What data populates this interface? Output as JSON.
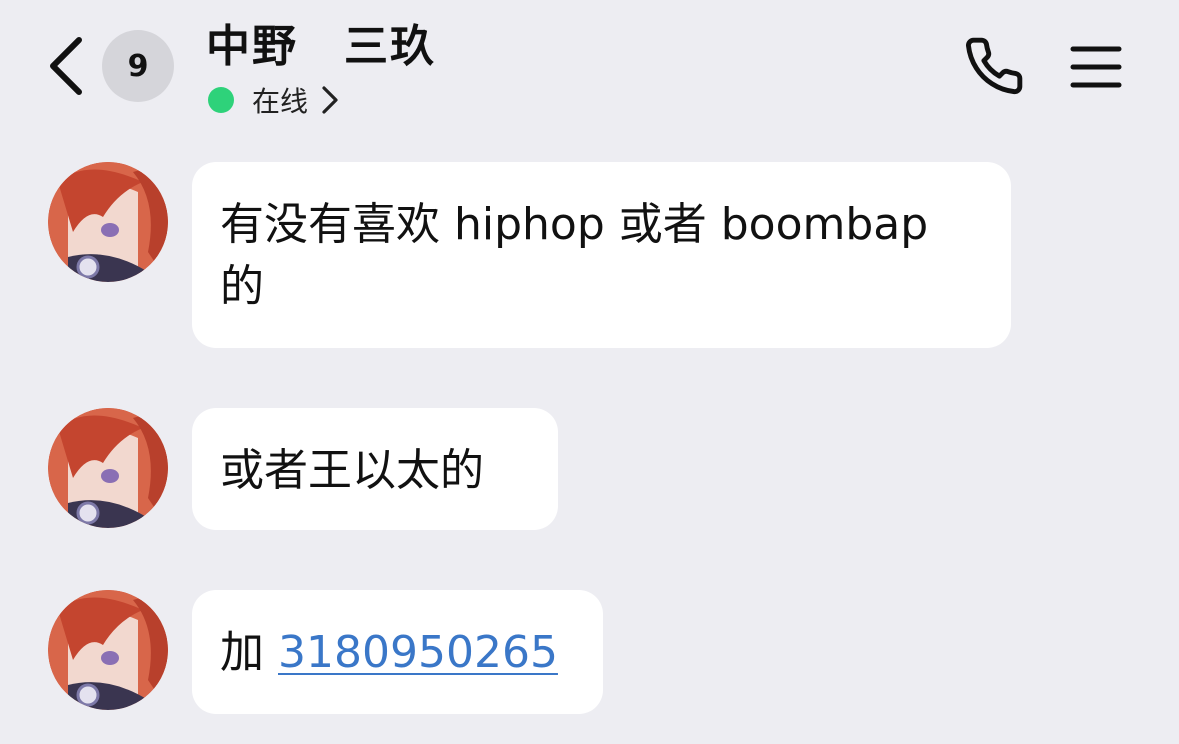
{
  "header": {
    "unread_count": "9",
    "contact_name": "中野　三玖",
    "status_text": "在线",
    "status_color": "#2ed27a"
  },
  "icons": {
    "back": "chevron-left-icon",
    "status_chevron": "chevron-right-icon",
    "call": "phone-icon",
    "menu": "hamburger-menu-icon"
  },
  "messages": [
    {
      "text": "有没有喜欢 hiphop 或者 boombap 的"
    },
    {
      "text": "或者王以太的"
    },
    {
      "prefix": "加 ",
      "link": "3180950265"
    }
  ],
  "colors": {
    "background": "#ededf2",
    "bubble": "#ffffff",
    "link": "#3a77c8"
  }
}
